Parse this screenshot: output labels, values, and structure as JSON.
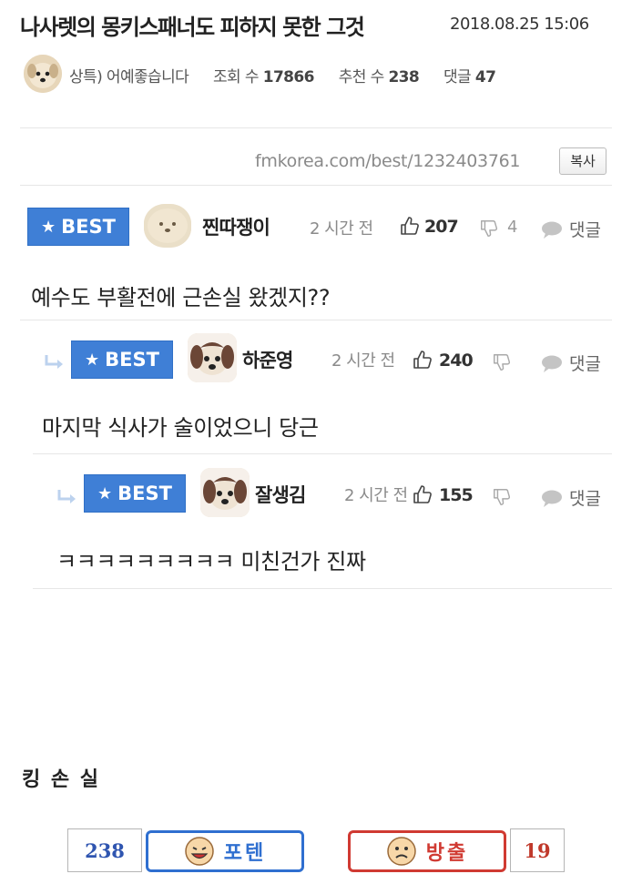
{
  "post": {
    "title": "나사렛의 몽키스패너도 피하지 못한 그것",
    "date": "2018.08.25 15:06",
    "author": "상특) 어예좋습니다",
    "views_label": "조회 수",
    "views": "17866",
    "recommend_label": "추천 수",
    "recommend": "238",
    "comments_label": "댓글",
    "comments": "47",
    "url": "fmkorea.com/best/1232403761",
    "copy_label": "복사"
  },
  "comments": [
    {
      "badge": "BEST",
      "nickname": "찐따쟁이",
      "time": "2 시간 전",
      "likes": "207",
      "dislikes": "4",
      "reply_label": "댓글",
      "text": "예수도 부활전에 근손실 왔겠지??"
    },
    {
      "badge": "BEST",
      "nickname": "하준영",
      "time": "2 시간 전",
      "likes": "240",
      "dislikes": "",
      "reply_label": "댓글",
      "text": "마지막 식사가 술이었으니 당근"
    },
    {
      "badge": "BEST",
      "nickname": "잘생김",
      "time": "2 시간 전",
      "likes": "155",
      "dislikes": "",
      "reply_label": "댓글",
      "text": "ㅋㅋㅋㅋㅋㅋㅋㅋㅋ 미친건가 진짜"
    }
  ],
  "footer": {
    "caption": "킹 손 실",
    "upvote_count": "238",
    "upvote_label": "포텐",
    "downvote_label": "방출",
    "downvote_count": "19"
  },
  "colors": {
    "best_badge": "#3f7fd6",
    "upvote_border": "#2f6fd0",
    "downvote_border": "#d03a32"
  },
  "icons": [
    "dog-avatar-icon",
    "star-icon",
    "thumbs-up-icon",
    "thumbs-down-icon",
    "speech-bubble-icon",
    "reply-arrow-icon",
    "smiley-icon",
    "sad-face-icon"
  ]
}
